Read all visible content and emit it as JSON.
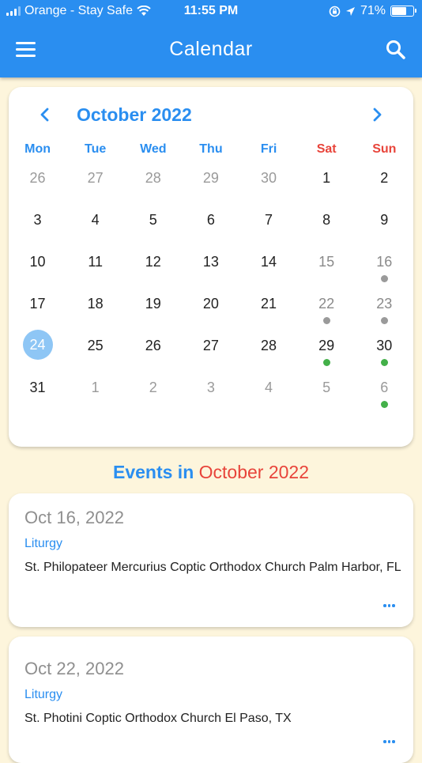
{
  "status_bar": {
    "carrier": "Orange - Stay Safe",
    "time": "11:55 PM",
    "battery_percent": "71%",
    "battery_level": 0.71,
    "icons": [
      "signal-icon",
      "wifi-icon",
      "orientation-lock-icon",
      "location-arrow-icon",
      "battery-icon"
    ]
  },
  "header": {
    "title": "Calendar",
    "menu_icon": "hamburger-menu-icon",
    "search_icon": "search-icon",
    "color": "#2a8ef0"
  },
  "calendar": {
    "month_label": "October 2022",
    "prev_icon": "chevron-left-icon",
    "next_icon": "chevron-right-icon",
    "weekdays": [
      "Mon",
      "Tue",
      "Wed",
      "Thu",
      "Fri",
      "Sat",
      "Sun"
    ],
    "days": [
      {
        "label": "26",
        "muted": true
      },
      {
        "label": "27",
        "muted": true
      },
      {
        "label": "28",
        "muted": true
      },
      {
        "label": "29",
        "muted": true
      },
      {
        "label": "30",
        "muted": true
      },
      {
        "label": "1"
      },
      {
        "label": "2"
      },
      {
        "label": "3"
      },
      {
        "label": "4"
      },
      {
        "label": "5"
      },
      {
        "label": "6"
      },
      {
        "label": "7"
      },
      {
        "label": "8"
      },
      {
        "label": "9"
      },
      {
        "label": "10"
      },
      {
        "label": "11"
      },
      {
        "label": "12"
      },
      {
        "label": "13"
      },
      {
        "label": "14"
      },
      {
        "label": "15",
        "weekend_grey": true
      },
      {
        "label": "16",
        "weekend_grey": true,
        "dot": "grey"
      },
      {
        "label": "17"
      },
      {
        "label": "18"
      },
      {
        "label": "19"
      },
      {
        "label": "20"
      },
      {
        "label": "21"
      },
      {
        "label": "22",
        "weekend_grey": true,
        "dot": "grey"
      },
      {
        "label": "23",
        "weekend_grey": true,
        "dot": "grey"
      },
      {
        "label": "24",
        "selected": true
      },
      {
        "label": "25"
      },
      {
        "label": "26"
      },
      {
        "label": "27"
      },
      {
        "label": "28"
      },
      {
        "label": "29",
        "dot": "green"
      },
      {
        "label": "30",
        "dot": "green"
      },
      {
        "label": "31"
      },
      {
        "label": "1",
        "muted": true
      },
      {
        "label": "2",
        "muted": true
      },
      {
        "label": "3",
        "muted": true
      },
      {
        "label": "4",
        "muted": true
      },
      {
        "label": "5",
        "muted": true
      },
      {
        "label": "6",
        "muted": true,
        "dot": "green"
      }
    ]
  },
  "events": {
    "heading_prefix": "Events in",
    "heading_month": "October 2022",
    "items": [
      {
        "date": "Oct 16, 2022",
        "type": "Liturgy",
        "location": "St. Philopateer Mercurius Coptic Orthodox Church Palm Harbor, FL"
      },
      {
        "date": "Oct 22, 2022",
        "type": "Liturgy",
        "location": "St. Photini Coptic Orthodox Church El Paso, TX"
      }
    ]
  }
}
